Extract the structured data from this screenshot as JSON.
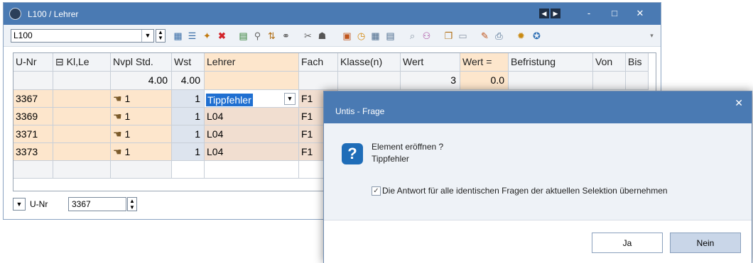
{
  "window": {
    "title": "L100 / Lehrer",
    "minimize": "-",
    "maximize": "□",
    "close": "✕"
  },
  "toolbar": {
    "combo_value": "L100"
  },
  "grid": {
    "headers": [
      "U-Nr",
      "⊟ Kl,Le",
      "Nvpl Std.",
      "Wst",
      "Lehrer",
      "Fach",
      "Klasse(n)",
      "Wert",
      "Wert =",
      "Befristung",
      "Von",
      "Bis"
    ],
    "totals": {
      "nvpl": "4.00",
      "wst": "4.00",
      "wert": "3",
      "wert_eq": "0.0"
    },
    "rows": [
      {
        "unr": "3367",
        "nvpl": "1",
        "wst": "1",
        "lehrer": "Tippfehler",
        "fach": "F1"
      },
      {
        "unr": "3369",
        "nvpl": "1",
        "wst": "1",
        "lehrer": "L04",
        "fach": "F1"
      },
      {
        "unr": "3371",
        "nvpl": "1",
        "wst": "1",
        "lehrer": "L04",
        "fach": "F1"
      },
      {
        "unr": "3373",
        "nvpl": "1",
        "wst": "1",
        "lehrer": "L04",
        "fach": "F1"
      }
    ]
  },
  "bottom": {
    "label": "U-Nr",
    "value": "3367"
  },
  "dialog": {
    "title": "Untis - Frage",
    "message_line1": "Element eröffnen ?",
    "message_line2": "Tippfehler",
    "checkbox_label": "Die Antwort für alle identischen Fragen der aktuellen Selektion übernehmen",
    "checked": true,
    "yes": "Ja",
    "no": "Nein"
  }
}
